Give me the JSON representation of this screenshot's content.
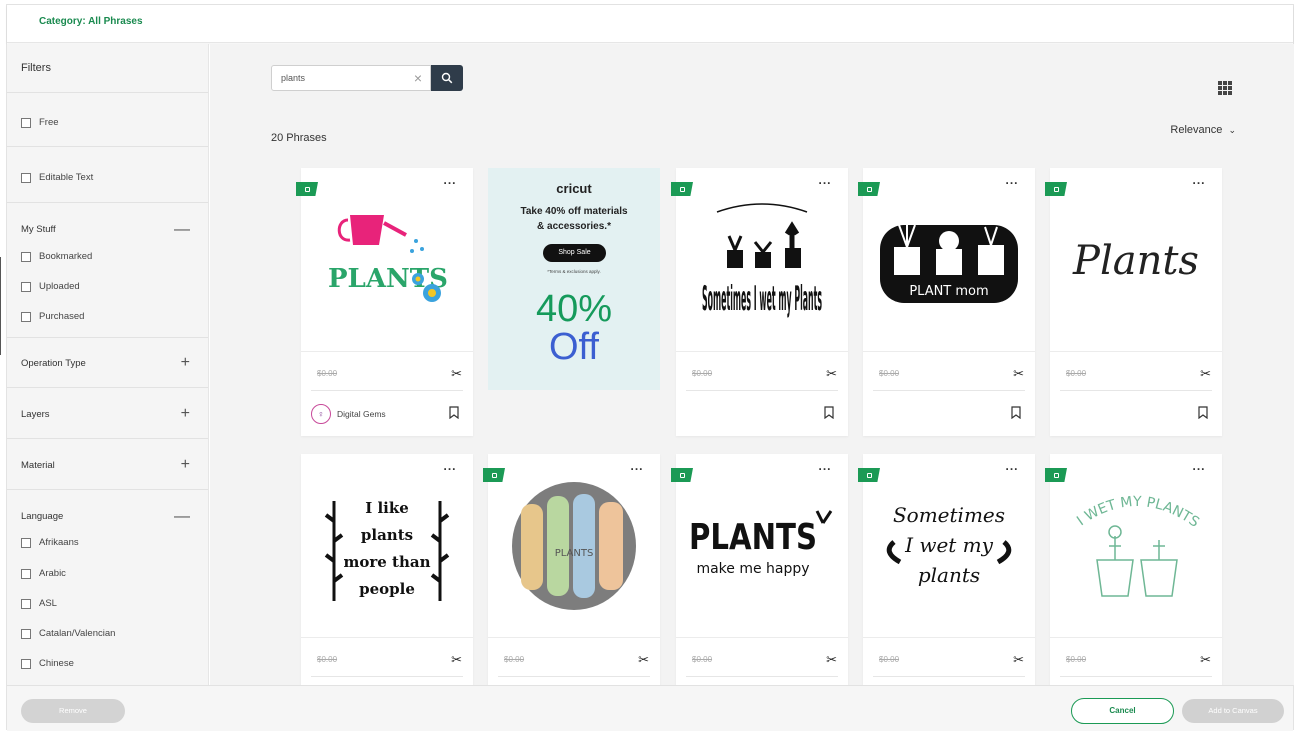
{
  "header": {
    "category": "Category: All Phrases"
  },
  "sidebar": {
    "title": "Filters",
    "free": "Free",
    "editable_text": "Editable Text",
    "my_stuff": {
      "title": "My Stuff",
      "items": [
        "Bookmarked",
        "Uploaded",
        "Purchased"
      ]
    },
    "operation_type": "Operation Type",
    "layers": "Layers",
    "material": "Material",
    "language": {
      "title": "Language",
      "items": [
        "Afrikaans",
        "Arabic",
        "ASL",
        "Catalan/Valencian",
        "Chinese"
      ]
    }
  },
  "search": {
    "value": "plants",
    "placeholder": ""
  },
  "results": {
    "count_text": "20 Phrases",
    "sort_label": "Relevance"
  },
  "ad": {
    "brand": "cricut",
    "text_line1": "Take 40% off materials",
    "text_line2": "& accessories.*",
    "button": "Shop Sale",
    "terms": "*Terms & exclusions apply.",
    "big_pct": "40%",
    "big_off": "Off"
  },
  "cards": [
    {
      "price": "$0.00",
      "author": "Digital Gems",
      "art_text": "PLANTS"
    },
    {
      "price": "$0.00",
      "author": "",
      "art_text": "Sometimes I wet my Plants"
    },
    {
      "price": "$0.00",
      "author": "",
      "art_text": "PLANT mom"
    },
    {
      "price": "$0.00",
      "author": "",
      "art_text": "Plants"
    },
    {
      "price": "$0.00",
      "author": "",
      "art_text": "I like plants more than people"
    },
    {
      "price": "$0.00",
      "author": "",
      "art_text": "PLANTS"
    },
    {
      "price": "$0.00",
      "author": "",
      "art_text_line1": "PLANTS",
      "art_text_line2": "make me happy"
    },
    {
      "price": "$0.00",
      "author": "",
      "art_text": "Sometimes I wet my plants"
    },
    {
      "price": "$0.00",
      "author": "",
      "art_text": "I WET MY PLANTS"
    }
  ],
  "footer": {
    "remove": "Remove",
    "cancel": "Cancel",
    "add": "Add to Canvas"
  },
  "colors": {
    "accent": "#1b9a55",
    "search_button": "#2f3c4a",
    "ad_bg": "#e3f1f2",
    "pct": "#159a5b",
    "off": "#3c5fd1"
  }
}
